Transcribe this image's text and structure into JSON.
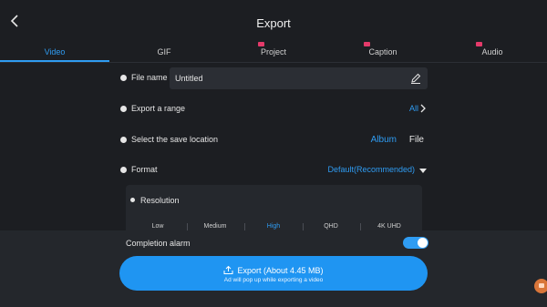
{
  "header": {
    "title": "Export"
  },
  "tabs": [
    {
      "label": "Video",
      "active": true,
      "premium": false
    },
    {
      "label": "GIF",
      "active": false,
      "premium": false
    },
    {
      "label": "Project",
      "active": false,
      "premium": true
    },
    {
      "label": "Caption",
      "active": false,
      "premium": true
    },
    {
      "label": "Audio",
      "active": false,
      "premium": true
    }
  ],
  "settings": {
    "file_name": {
      "label": "File name",
      "value": "Untitled"
    },
    "range": {
      "label": "Export a range",
      "value": "All"
    },
    "save_location": {
      "label": "Select the save location",
      "option_album": "Album",
      "option_file": "File",
      "selected": "Album"
    },
    "format": {
      "label": "Format",
      "value": "Default(Recommended)"
    },
    "resolution": {
      "label": "Resolution",
      "options": [
        "Low",
        "Medium",
        "High",
        "QHD",
        "4K UHD"
      ],
      "selected": "High"
    }
  },
  "completion_alarm": {
    "label": "Completion alarm",
    "enabled": true
  },
  "export_button": {
    "label": "Export (About 4.45 MB)",
    "sublabel": "Ad will pop up while exporting a video"
  },
  "colors": {
    "accent": "#2f9cf2",
    "premium_badge": "#e53a6a",
    "background": "#1c1e22"
  }
}
